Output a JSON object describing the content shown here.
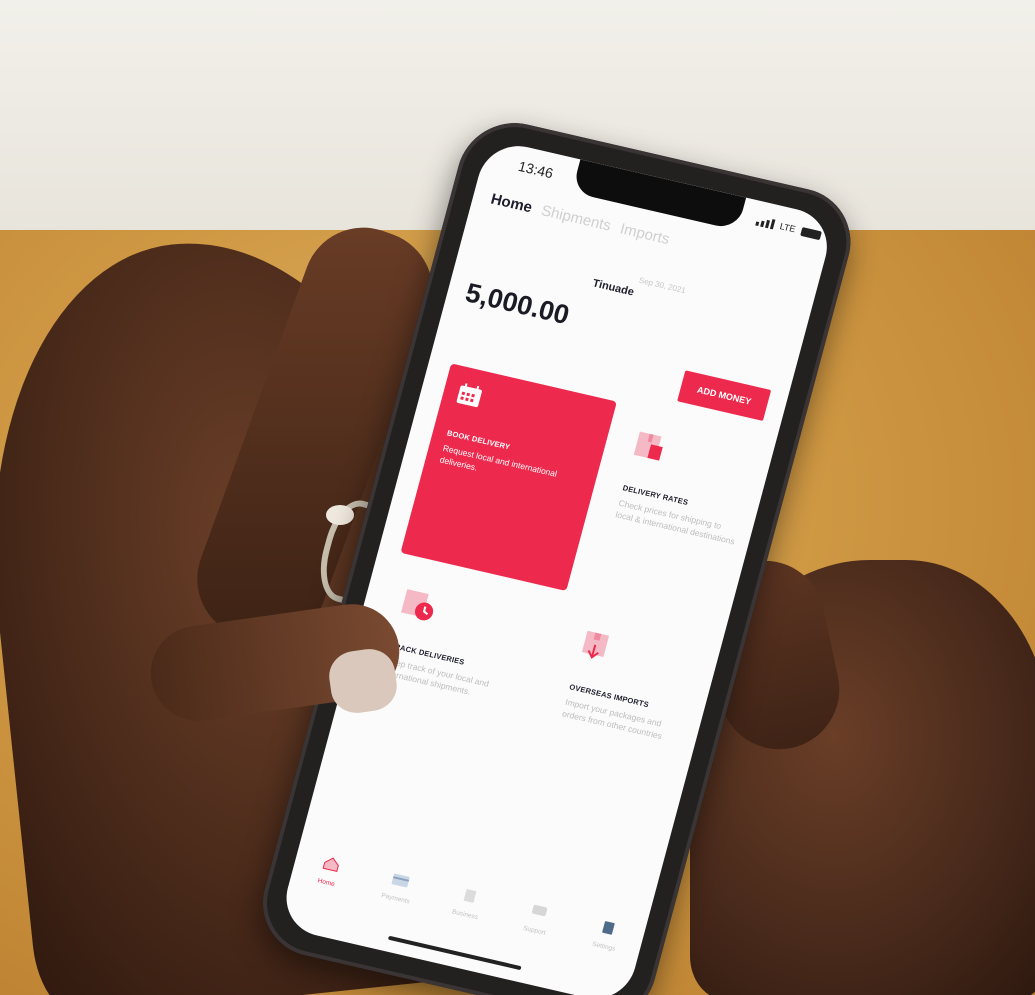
{
  "status_bar": {
    "time": "13:46",
    "network": "LTE"
  },
  "tabs": [
    {
      "label": "Home",
      "active": true
    },
    {
      "label": "Shipments",
      "active": false
    },
    {
      "label": "Imports",
      "active": false
    }
  ],
  "header": {
    "date": "Sep 30, 2021",
    "user_name": "Tinuade"
  },
  "wallet": {
    "balance": "5,000.00",
    "add_money_label": "ADD MONEY"
  },
  "cards": [
    {
      "title": "BOOK DELIVERY",
      "description": "Request local and international deliveries.",
      "icon": "calendar-icon"
    },
    {
      "title": "DELIVERY RATES",
      "description": "Check prices for shipping to local & international destinations",
      "icon": "package-tag-icon"
    },
    {
      "title": "TRACK DELIVERIES",
      "description": "Keep track of your local and international shipments.",
      "icon": "clock-package-icon"
    },
    {
      "title": "OVERSEAS IMPORTS",
      "description": "Import your packages and orders from other countries",
      "icon": "import-box-icon"
    }
  ],
  "bottom_nav": [
    {
      "label": "Home",
      "icon": "home-icon",
      "active": true
    },
    {
      "label": "Payments",
      "icon": "card-icon",
      "active": false
    },
    {
      "label": "Business",
      "icon": "building-icon",
      "active": false
    },
    {
      "label": "Support",
      "icon": "chat-icon",
      "active": false
    },
    {
      "label": "Settings",
      "icon": "settings-icon",
      "active": false
    }
  ],
  "colors": {
    "accent": "#ed2a4d",
    "text_dark": "#1e1e2d",
    "muted": "#bdbdbd"
  }
}
